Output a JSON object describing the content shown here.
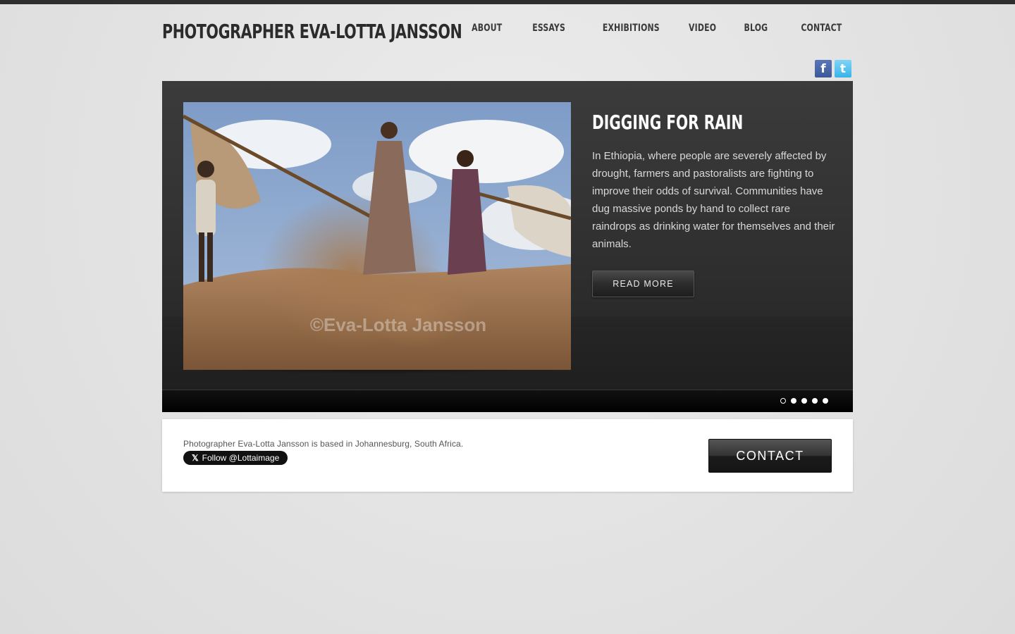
{
  "site": {
    "title": "Photographer Eva-Lotta Jansson"
  },
  "nav": {
    "items": [
      "About",
      "Essays",
      "Exhibitions",
      "Video",
      "Blog",
      "Contact"
    ]
  },
  "social": {
    "facebook_glyph": "f",
    "twitter_glyph": "t",
    "facebook_color": "#3b5998",
    "twitter_color": "#38b4e8"
  },
  "slide": {
    "title": "Digging for Rain",
    "text": "In Ethiopia, where people are severely affected by drought, farmers and pastoralists are fighting to improve their odds of survival. Communities have dug massive ponds by hand to collect rare raindrops as drinking water for themselves and their animals.",
    "button": "Read More",
    "watermark": "©Eva-Lotta Jansson",
    "dot_count": 5,
    "active_index": 0
  },
  "footer": {
    "about": "Photographer Eva-Lotta Jansson is based in Johannesburg, South Africa.",
    "follow_label": "Follow @Lottaimage",
    "follow_glyph": "𝕏",
    "contact_button": "Contact"
  }
}
